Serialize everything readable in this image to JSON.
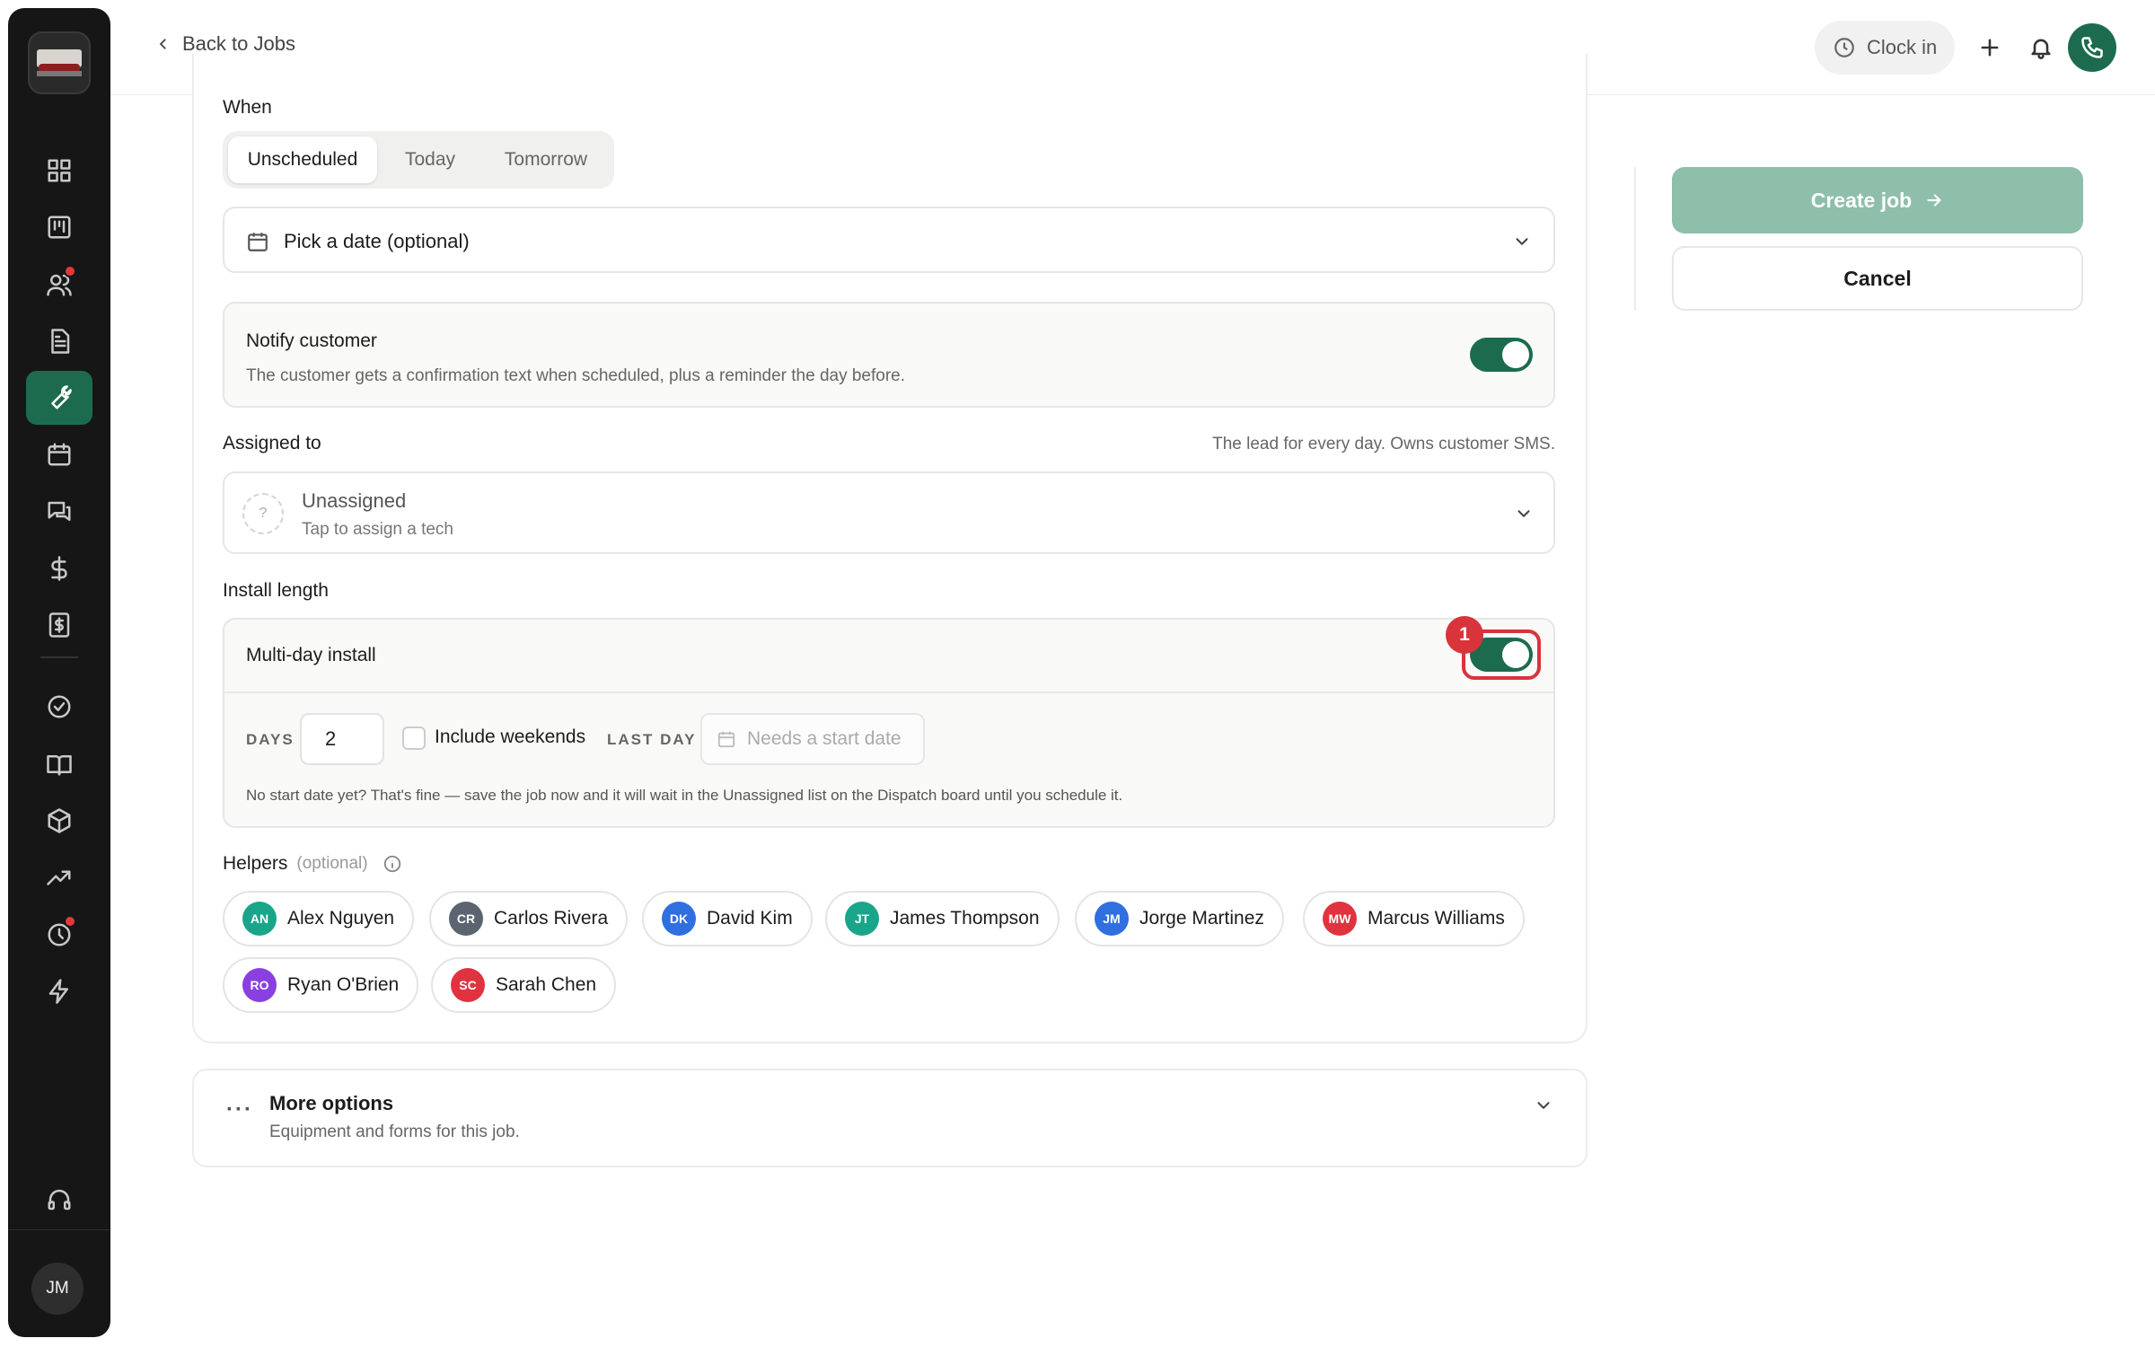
{
  "topbar": {
    "back_label": "Back to Jobs",
    "clock_label": "Clock in",
    "icons": [
      "plus-icon",
      "bell-icon",
      "phone-icon"
    ]
  },
  "sidebar": {
    "user_initials": "JM",
    "items": [
      {
        "name": "dashboard",
        "icon": "grid-icon"
      },
      {
        "name": "board",
        "icon": "kanban-icon"
      },
      {
        "name": "customers",
        "icon": "users-icon",
        "notification": true
      },
      {
        "name": "documents",
        "icon": "document-icon"
      },
      {
        "name": "jobs",
        "icon": "wrench-icon",
        "active": true
      },
      {
        "name": "calendar",
        "icon": "calendar-icon"
      },
      {
        "name": "messages",
        "icon": "chat-icon"
      },
      {
        "name": "payments",
        "icon": "dollar-icon"
      },
      {
        "name": "invoices",
        "icon": "invoice-icon"
      },
      {
        "name": "tasks",
        "icon": "check-circle-icon"
      },
      {
        "name": "library",
        "icon": "book-icon"
      },
      {
        "name": "inventory",
        "icon": "box-icon"
      },
      {
        "name": "reports",
        "icon": "trend-icon"
      },
      {
        "name": "timesheets",
        "icon": "clock-icon",
        "notification": true
      },
      {
        "name": "automations",
        "icon": "bolt-icon"
      },
      {
        "name": "support",
        "icon": "headset-icon"
      }
    ]
  },
  "form": {
    "when_label": "When",
    "when_options": [
      "Unscheduled",
      "Today",
      "Tomorrow"
    ],
    "when_selected": "Unscheduled",
    "date_placeholder": "Pick a date (optional)",
    "notify": {
      "title": "Notify customer",
      "description": "The customer gets a confirmation text when scheduled, plus a reminder the day before.",
      "enabled": true
    },
    "assigned": {
      "label": "Assigned to",
      "hint": "The lead for every day. Owns customer SMS.",
      "avatar_glyph": "?",
      "value": "Unassigned",
      "subtext": "Tap to assign a tech"
    },
    "install": {
      "section_label": "Install length",
      "multiday_label": "Multi-day install",
      "multiday_enabled": true,
      "highlight_badge": "1",
      "days_label": "DAYS",
      "days_value": "2",
      "weekends_label": "Include weekends",
      "weekends_checked": false,
      "lastday_label": "LAST DAY",
      "lastday_placeholder": "Needs a start date",
      "note": "No start date yet? That's fine — save the job now and it will wait in the Unassigned list on the Dispatch board until you schedule it."
    },
    "helpers": {
      "label": "Helpers",
      "optional": "(optional)",
      "people": [
        {
          "initials": "AN",
          "name": "Alex Nguyen",
          "color": "#1aa58a"
        },
        {
          "initials": "CR",
          "name": "Carlos Rivera",
          "color": "#5b6470"
        },
        {
          "initials": "DK",
          "name": "David Kim",
          "color": "#2f6fe0"
        },
        {
          "initials": "JT",
          "name": "James Thompson",
          "color": "#1aa58a"
        },
        {
          "initials": "JM",
          "name": "Jorge Martinez",
          "color": "#2f6fe0"
        },
        {
          "initials": "MW",
          "name": "Marcus Williams",
          "color": "#e0333f"
        },
        {
          "initials": "RO",
          "name": "Ryan O'Brien",
          "color": "#8a3fe0"
        },
        {
          "initials": "SC",
          "name": "Sarah Chen",
          "color": "#e0333f"
        }
      ]
    },
    "more_options": {
      "title": "More options",
      "subtitle": "Equipment and forms for this job."
    }
  },
  "actions": {
    "create_label": "Create job",
    "cancel_label": "Cancel"
  },
  "colors": {
    "brand_green": "#1d6b4f",
    "create_disabled": "#8dbfaa",
    "highlight_red": "#d9343b"
  }
}
